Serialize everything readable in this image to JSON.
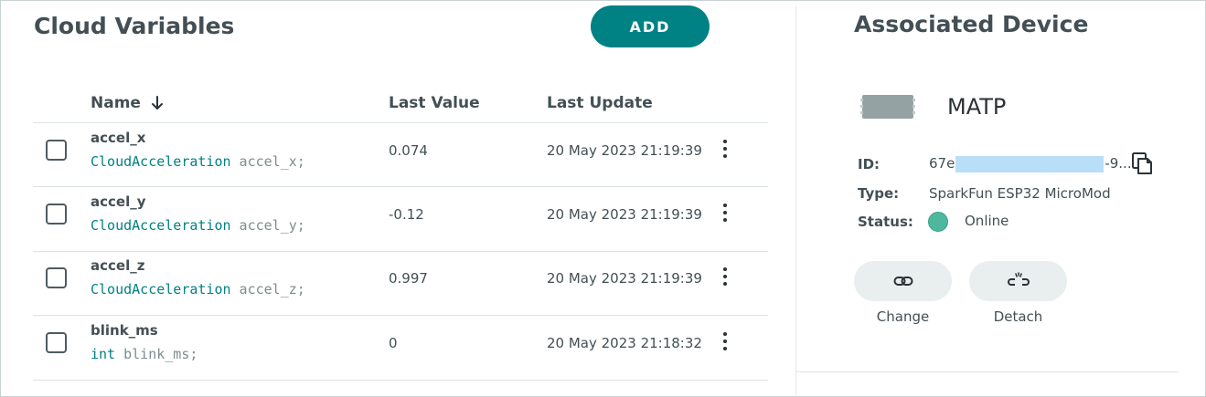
{
  "left": {
    "title": "Cloud Variables",
    "add_label": "ADD",
    "columns": {
      "name": "Name",
      "last_value": "Last Value",
      "last_update": "Last Update"
    },
    "rows": [
      {
        "name": "accel_x",
        "type": "CloudAcceleration",
        "decl": " accel_x;",
        "value": "0.074",
        "updated": "20 May 2023 21:19:39"
      },
      {
        "name": "accel_y",
        "type": "CloudAcceleration",
        "decl": " accel_y;",
        "value": "-0.12",
        "updated": "20 May 2023 21:19:39"
      },
      {
        "name": "accel_z",
        "type": "CloudAcceleration",
        "decl": " accel_z;",
        "value": "0.997",
        "updated": "20 May 2023 21:19:39"
      },
      {
        "name": "blink_ms",
        "type": "int",
        "decl": " blink_ms;",
        "value": "0",
        "updated": "20 May 2023 21:18:32"
      }
    ]
  },
  "right": {
    "title": "Associated Device",
    "device_name": "MATP",
    "id_label": "ID:",
    "id_prefix": "67e",
    "id_suffix": "-9...",
    "type_label": "Type:",
    "type_value": "SparkFun ESP32 MicroMod",
    "status_label": "Status:",
    "status_value": "Online",
    "change_label": "Change",
    "detach_label": "Detach"
  },
  "colors": {
    "accent": "#008184",
    "online": "#4db89e",
    "redaction": "#b9def7"
  },
  "icons": [
    "sort-arrow-down-icon",
    "kebab-menu-icon",
    "board-icon",
    "copy-icon",
    "link-icon",
    "unlink-icon"
  ]
}
